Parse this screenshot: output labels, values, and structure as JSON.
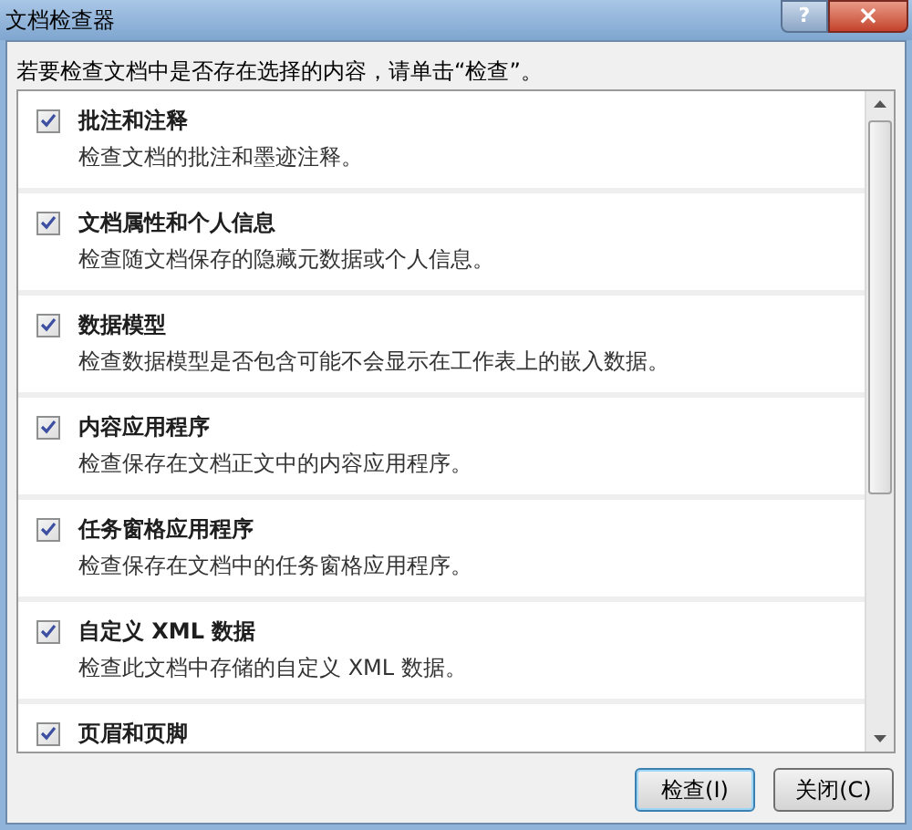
{
  "window": {
    "title": "文档检查器",
    "help": "?",
    "close": "×"
  },
  "instruction": "若要检查文档中是否存在选择的内容，请单击“检查”。",
  "items": [
    {
      "title": "批注和注释",
      "description": "检查文档的批注和墨迹注释。",
      "checked": true
    },
    {
      "title": "文档属性和个人信息",
      "description": "检查随文档保存的隐藏元数据或个人信息。",
      "checked": true
    },
    {
      "title": "数据模型",
      "description": "检查数据模型是否包含可能不会显示在工作表上的嵌入数据。",
      "checked": true
    },
    {
      "title": "内容应用程序",
      "description": "检查保存在文档正文中的内容应用程序。",
      "checked": true
    },
    {
      "title": "任务窗格应用程序",
      "description": "检查保存在文档中的任务窗格应用程序。",
      "checked": true
    },
    {
      "title": "自定义 XML 数据",
      "description": "检查此文档中存储的自定义 XML 数据。",
      "checked": true
    },
    {
      "title": "页眉和页脚",
      "checked": true
    }
  ],
  "buttons": [
    {
      "label": "检查(I)",
      "default": true
    },
    {
      "label": "关闭(C)",
      "default": false
    }
  ]
}
